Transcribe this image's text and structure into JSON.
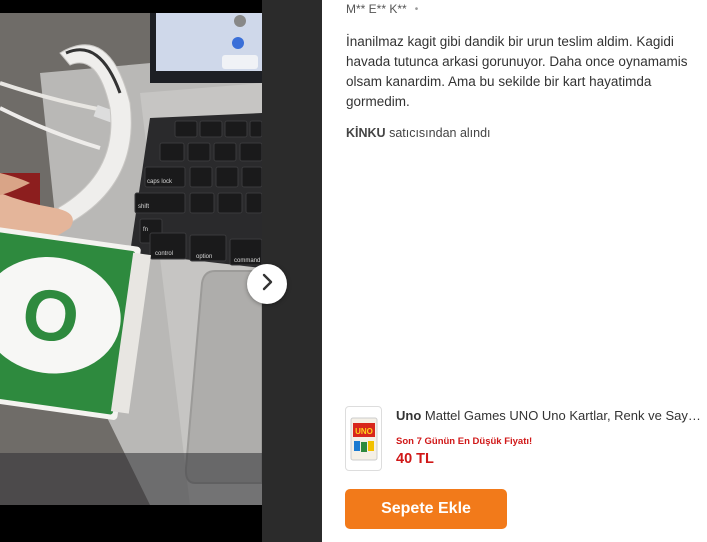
{
  "review": {
    "reviewer": "M** E** K**",
    "text": "İnanilmaz kagit gibi dandik bir urun teslim aldim. Kagidi havada tutunca arkasi gorunuyor. Daha once oynamamis olsam kanardim. Ama bu sekilde bir kart hayatimda gormedim.",
    "seller_name": "KİNKU",
    "seller_suffix": " satıcısından alındı"
  },
  "photo": {
    "keys": [
      "caps lock",
      "shift",
      "fn",
      "control",
      "option",
      "command"
    ],
    "card_letter": "O"
  },
  "gallery": {
    "next_icon": "chevron-right-icon"
  },
  "product": {
    "brand": "Uno",
    "title": " Mattel Games UNO Uno Kartlar, Renk ve Sayı Eşleştirme",
    "lowest_price_label": "Son 7 Günün En Düşük Fiyatı!",
    "price": "40 TL",
    "thumb_logo": "UNO"
  },
  "actions": {
    "add_to_cart": "Sepete Ekle"
  },
  "colors": {
    "accent": "#f27a1a",
    "price": "#d01818",
    "uno_green": "#2e8a3e"
  }
}
